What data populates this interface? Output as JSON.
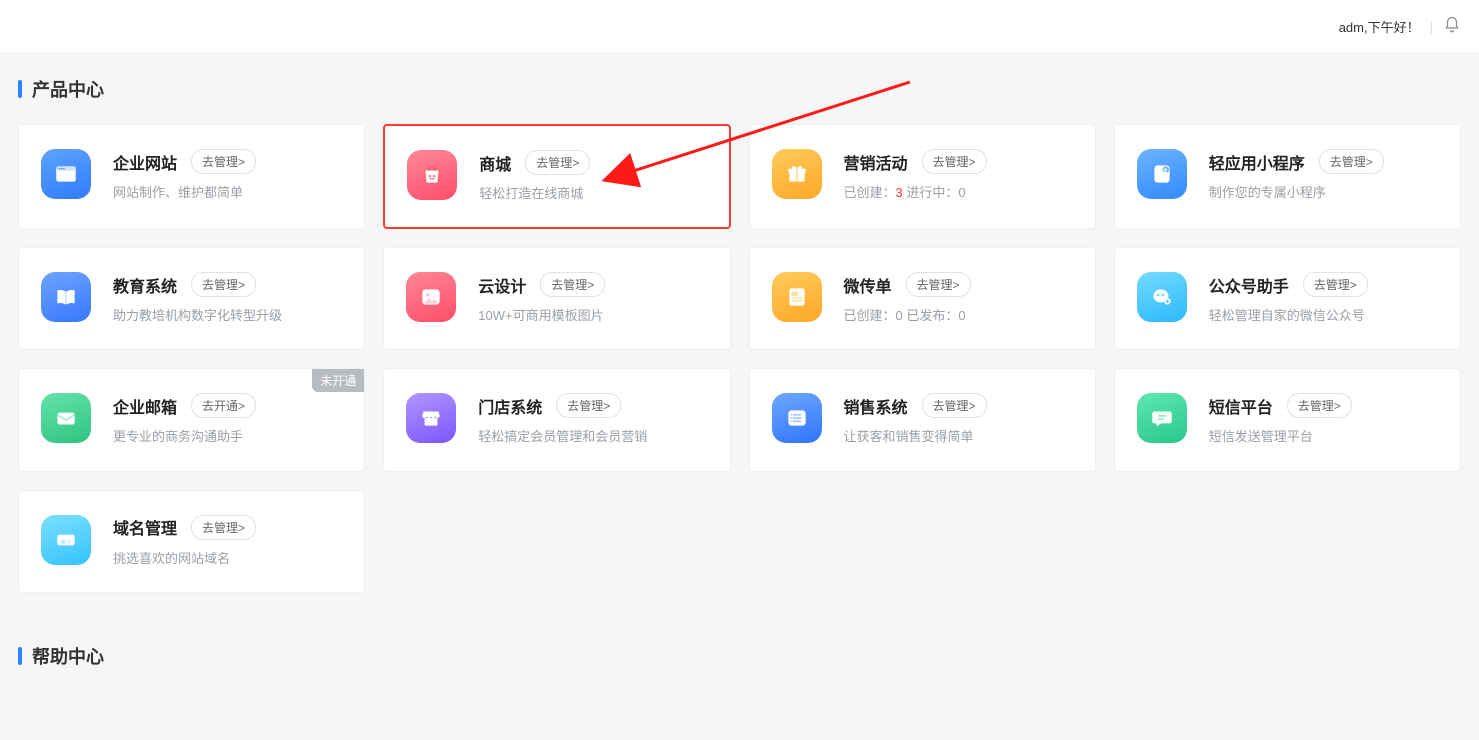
{
  "header": {
    "greeting": "adm,下午好！"
  },
  "sections": {
    "products_title": "产品中心",
    "help_title": "帮助中心"
  },
  "cards": [
    {
      "id": "site",
      "title": "企业网站",
      "button": "去管理>",
      "desc": "网站制作、维护都简单",
      "icon_bg": "#3f8cff"
    },
    {
      "id": "mall",
      "title": "商城",
      "button": "去管理>",
      "desc": "轻松打造在线商城",
      "icon_bg": "#ff5d6c",
      "highlight": true
    },
    {
      "id": "marketing",
      "title": "营销活动",
      "button": "去管理>",
      "desc_parts": [
        "已创建：",
        "3",
        "   进行中：",
        "0"
      ],
      "icon_bg": "#ffb33a"
    },
    {
      "id": "miniapp",
      "title": "轻应用小程序",
      "button": "去管理>",
      "desc": "制作您的专属小程序",
      "icon_bg": "#4a97ff"
    },
    {
      "id": "edu",
      "title": "教育系统",
      "button": "去管理>",
      "desc": "助力教培机构数字化转型升级",
      "icon_bg": "#4a8bff"
    },
    {
      "id": "design",
      "title": "云设计",
      "button": "去管理>",
      "desc": "10W+可商用模板图片",
      "icon_bg": "#ff5d6c"
    },
    {
      "id": "flyer",
      "title": "微传单",
      "button": "去管理>",
      "desc_parts": [
        "已创建：",
        "0",
        "   已发布：",
        "0"
      ],
      "icon_bg": "#ffb33a"
    },
    {
      "id": "wxhelper",
      "title": "公众号助手",
      "button": "去管理>",
      "desc": "轻松管理自家的微信公众号",
      "icon_bg": "#46c6ff"
    },
    {
      "id": "mail",
      "title": "企业邮箱",
      "button": "去开通>",
      "desc": "更专业的商务沟通助手",
      "icon_bg": "#3ecf8e",
      "corner": "未开通"
    },
    {
      "id": "store",
      "title": "门店系统",
      "button": "去管理>",
      "desc": "轻松搞定会员管理和会员营销",
      "icon_bg": "#8e6cff"
    },
    {
      "id": "sales",
      "title": "销售系统",
      "button": "去管理>",
      "desc": "让获客和销售变得简单",
      "icon_bg": "#3b82ff"
    },
    {
      "id": "sms",
      "title": "短信平台",
      "button": "去管理>",
      "desc": "短信发送管理平台",
      "icon_bg": "#37d399"
    },
    {
      "id": "domain",
      "title": "域名管理",
      "button": "去管理>",
      "desc": "挑选喜欢的网站域名",
      "icon_bg": "#4ad0ff"
    }
  ]
}
